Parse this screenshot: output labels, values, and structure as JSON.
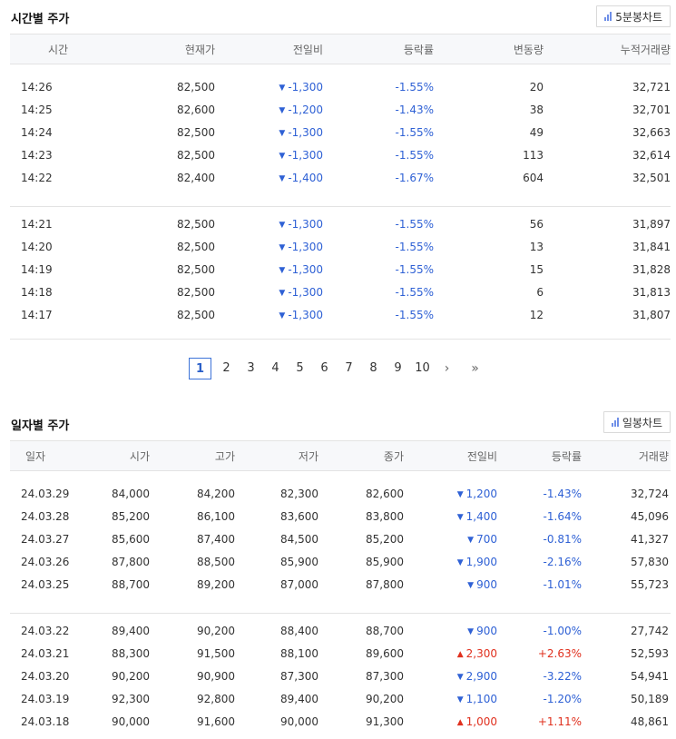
{
  "hourly": {
    "title": "시간별 주가",
    "chart_button": "5분봉차트",
    "columns": [
      "시간",
      "현재가",
      "전일비",
      "등락률",
      "변동량",
      "누적거래량"
    ],
    "groups": [
      [
        {
          "time": "14:26",
          "price": "82,500",
          "change": "-1,300",
          "dir": "down",
          "rate": "-1.55%",
          "vol": "20",
          "acc": "32,721"
        },
        {
          "time": "14:25",
          "price": "82,600",
          "change": "-1,200",
          "dir": "down",
          "rate": "-1.43%",
          "vol": "38",
          "acc": "32,701"
        },
        {
          "time": "14:24",
          "price": "82,500",
          "change": "-1,300",
          "dir": "down",
          "rate": "-1.55%",
          "vol": "49",
          "acc": "32,663"
        },
        {
          "time": "14:23",
          "price": "82,500",
          "change": "-1,300",
          "dir": "down",
          "rate": "-1.55%",
          "vol": "113",
          "acc": "32,614"
        },
        {
          "time": "14:22",
          "price": "82,400",
          "change": "-1,400",
          "dir": "down",
          "rate": "-1.67%",
          "vol": "604",
          "acc": "32,501"
        }
      ],
      [
        {
          "time": "14:21",
          "price": "82,500",
          "change": "-1,300",
          "dir": "down",
          "rate": "-1.55%",
          "vol": "56",
          "acc": "31,897"
        },
        {
          "time": "14:20",
          "price": "82,500",
          "change": "-1,300",
          "dir": "down",
          "rate": "-1.55%",
          "vol": "13",
          "acc": "31,841"
        },
        {
          "time": "14:19",
          "price": "82,500",
          "change": "-1,300",
          "dir": "down",
          "rate": "-1.55%",
          "vol": "15",
          "acc": "31,828"
        },
        {
          "time": "14:18",
          "price": "82,500",
          "change": "-1,300",
          "dir": "down",
          "rate": "-1.55%",
          "vol": "6",
          "acc": "31,813"
        },
        {
          "time": "14:17",
          "price": "82,500",
          "change": "-1,300",
          "dir": "down",
          "rate": "-1.55%",
          "vol": "12",
          "acc": "31,807"
        }
      ]
    ]
  },
  "pagination": {
    "current": "1",
    "pages": [
      "1",
      "2",
      "3",
      "4",
      "5",
      "6",
      "7",
      "8",
      "9",
      "10"
    ],
    "next": "›",
    "last": "»"
  },
  "daily": {
    "title": "일자별 주가",
    "chart_button": "일봉차트",
    "columns": [
      "일자",
      "시가",
      "고가",
      "저가",
      "종가",
      "전일비",
      "등락률",
      "거래량"
    ],
    "groups": [
      [
        {
          "date": "24.03.29",
          "open": "84,000",
          "high": "84,200",
          "low": "82,300",
          "close": "82,600",
          "change": "1,200",
          "dir": "down",
          "rate": "-1.43%",
          "vol": "32,724"
        },
        {
          "date": "24.03.28",
          "open": "85,200",
          "high": "86,100",
          "low": "83,600",
          "close": "83,800",
          "change": "1,400",
          "dir": "down",
          "rate": "-1.64%",
          "vol": "45,096"
        },
        {
          "date": "24.03.27",
          "open": "85,600",
          "high": "87,400",
          "low": "84,500",
          "close": "85,200",
          "change": "700",
          "dir": "down",
          "rate": "-0.81%",
          "vol": "41,327"
        },
        {
          "date": "24.03.26",
          "open": "87,800",
          "high": "88,500",
          "low": "85,900",
          "close": "85,900",
          "change": "1,900",
          "dir": "down",
          "rate": "-2.16%",
          "vol": "57,830"
        },
        {
          "date": "24.03.25",
          "open": "88,700",
          "high": "89,200",
          "low": "87,000",
          "close": "87,800",
          "change": "900",
          "dir": "down",
          "rate": "-1.01%",
          "vol": "55,723"
        }
      ],
      [
        {
          "date": "24.03.22",
          "open": "89,400",
          "high": "90,200",
          "low": "88,400",
          "close": "88,700",
          "change": "900",
          "dir": "down",
          "rate": "-1.00%",
          "vol": "27,742"
        },
        {
          "date": "24.03.21",
          "open": "88,300",
          "high": "91,500",
          "low": "88,100",
          "close": "89,600",
          "change": "2,300",
          "dir": "up",
          "rate": "+2.63%",
          "vol": "52,593"
        },
        {
          "date": "24.03.20",
          "open": "90,200",
          "high": "90,900",
          "low": "87,300",
          "close": "87,300",
          "change": "2,900",
          "dir": "down",
          "rate": "-3.22%",
          "vol": "54,941"
        },
        {
          "date": "24.03.19",
          "open": "92,300",
          "high": "92,800",
          "low": "89,400",
          "close": "90,200",
          "change": "1,100",
          "dir": "down",
          "rate": "-1.20%",
          "vol": "50,189"
        },
        {
          "date": "24.03.18",
          "open": "90,000",
          "high": "91,600",
          "low": "90,000",
          "close": "91,300",
          "change": "1,000",
          "dir": "up",
          "rate": "+1.11%",
          "vol": "48,861"
        }
      ]
    ]
  },
  "colors": {
    "down": "#2f61d5",
    "up": "#e0301e",
    "accent": "#3d73d8"
  },
  "icons": {
    "chart": "bar-chart-icon",
    "down": "triangle-down-icon",
    "up": "triangle-up-icon"
  }
}
